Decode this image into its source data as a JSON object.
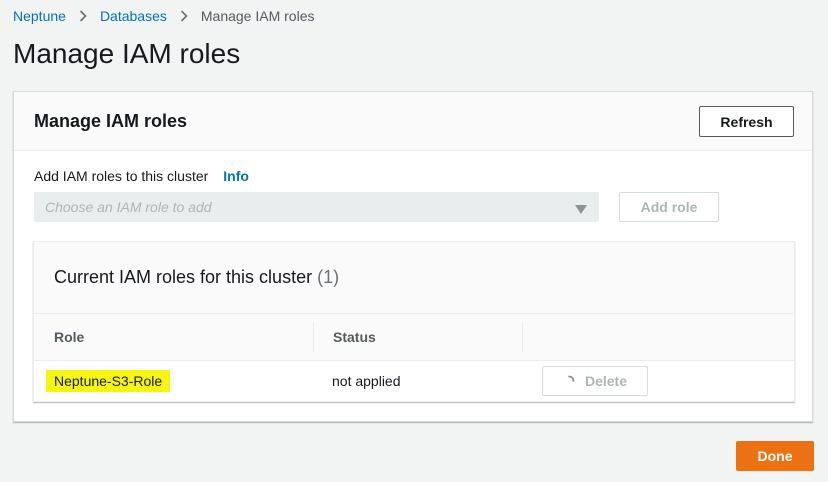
{
  "breadcrumb": {
    "items": [
      "Neptune",
      "Databases"
    ],
    "current": "Manage IAM roles"
  },
  "page_title": "Manage IAM roles",
  "panel": {
    "title": "Manage IAM roles",
    "refresh_label": "Refresh",
    "add_label": "Add IAM roles to this cluster",
    "info_label": "Info",
    "select_placeholder": "Choose an IAM role to add",
    "add_role_label": "Add role"
  },
  "roles_table": {
    "title": "Current IAM roles for this cluster",
    "count": "(1)",
    "columns": [
      "Role",
      "Status"
    ],
    "rows": [
      {
        "role": "Neptune-S3-Role",
        "status": "not applied",
        "action_label": "Delete"
      }
    ]
  },
  "footer": {
    "done_label": "Done"
  },
  "colors": {
    "link": "#0073bb",
    "primary_button": "#ec7211",
    "highlight": "#f5f50f"
  },
  "icons": [
    "chevron-right-icon",
    "caret-down-icon",
    "spinner-icon"
  ]
}
